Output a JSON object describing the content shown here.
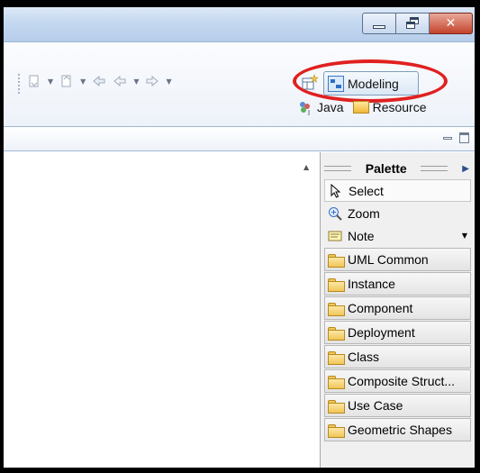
{
  "window": {
    "minimize_glyph": "–",
    "close_glyph": "✕"
  },
  "toolbar": {
    "icons": [
      "navigate-next-annotation-icon",
      "navigate-prev-annotation-icon",
      "last-edit-icon",
      "back-icon",
      "forward-icon"
    ]
  },
  "perspectives": {
    "open_icon": "open-perspective-icon",
    "active": "Modeling",
    "java": "Java",
    "resource": "Resource"
  },
  "palette": {
    "title": "Palette",
    "tools": [
      {
        "label": "Select",
        "icon": "arrow-cursor-icon"
      },
      {
        "label": "Zoom",
        "icon": "zoom-icon"
      },
      {
        "label": "Note",
        "icon": "note-icon"
      }
    ],
    "drawers": [
      "UML Common",
      "Instance",
      "Component",
      "Deployment",
      "Class",
      "Composite Struct...",
      "Use Case",
      "Geometric Shapes"
    ]
  },
  "colors": {
    "highlight": "#e02020",
    "titlebar": "#c4d8f0",
    "close_button": "#c4432b"
  }
}
